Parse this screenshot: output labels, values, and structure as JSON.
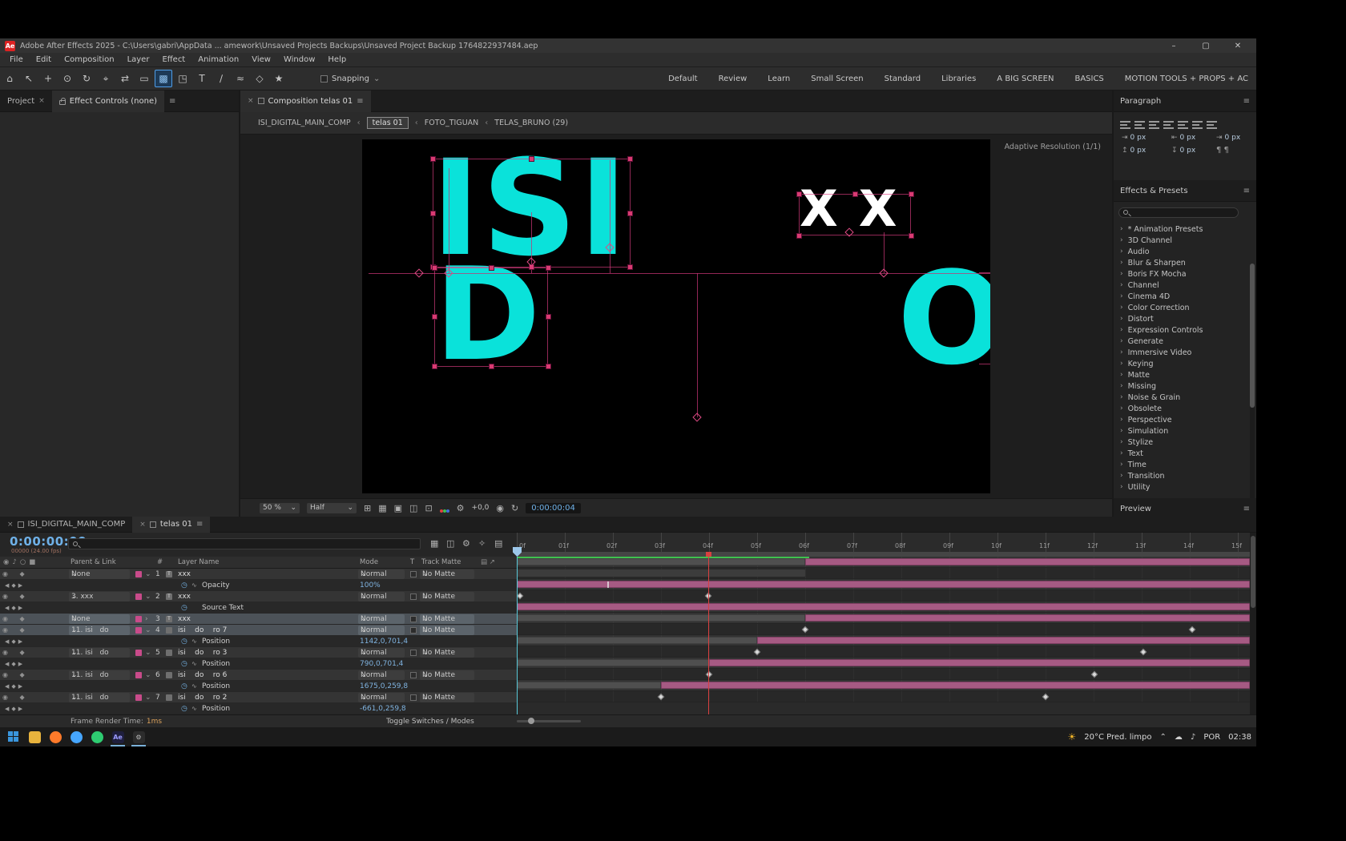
{
  "window": {
    "title": "Adobe After Effects 2025 - C:\\Users\\gabri\\AppData ... amework\\Unsaved Projects Backups\\Unsaved Project Backup 1764822937484.aep",
    "minimize": "–",
    "maximize": "▢",
    "close": "✕"
  },
  "menu": {
    "items": [
      "File",
      "Edit",
      "Composition",
      "Layer",
      "Effect",
      "Animation",
      "View",
      "Window",
      "Help"
    ]
  },
  "toolbar": {
    "snapping": "Snapping",
    "workspaces": [
      "Default",
      "Review",
      "Learn",
      "Small Screen",
      "Standard",
      "Libraries",
      "A BIG SCREEN",
      "BASICS",
      "MOTION TOOLS + PROPS + AC"
    ]
  },
  "panels": {
    "project_tab": "Project",
    "effect_controls_tab": "Effect Controls (none)"
  },
  "comp": {
    "tab": "Composition telas 01",
    "breadcrumbs": [
      "ISI_DIGITAL_MAIN_COMP",
      "telas 01",
      "FOTO_TIGUAN",
      "TELAS_BRUNO (29)"
    ],
    "adaptive_resolution": "Adaptive Resolution (1/1)",
    "canvas": {
      "word_top": "ISI",
      "letter_d": "D",
      "letter_o": "O",
      "xx": "XX"
    },
    "zoom": "50 %",
    "resolution": "Half",
    "exposure": "+0,0",
    "timecode": "0:00:00:04"
  },
  "paragraph": {
    "title": "Paragraph",
    "f1": "0 px",
    "f2": "0 px",
    "f3": "0 px",
    "f4": "0 px",
    "f5": "0 px"
  },
  "effects": {
    "title": "Effects & Presets",
    "items": [
      "* Animation Presets",
      "3D Channel",
      "Audio",
      "Blur & Sharpen",
      "Boris FX Mocha",
      "Channel",
      "Cinema 4D",
      "Color Correction",
      "Distort",
      "Expression Controls",
      "Generate",
      "Immersive Video",
      "Keying",
      "Matte",
      "Missing",
      "Noise & Grain",
      "Obsolete",
      "Perspective",
      "Simulation",
      "Stylize",
      "Text",
      "Time",
      "Transition",
      "Utility"
    ]
  },
  "preview": {
    "title": "Preview"
  },
  "timeline": {
    "tab1": "ISI_DIGITAL_MAIN_COMP",
    "tab2": "telas 01",
    "timecode": "0:00:00:00",
    "fps": "00000 (24.00 fps)",
    "h_parent": "Parent & Link",
    "h_name": "Layer Name",
    "h_mode": "Mode",
    "h_t": "T",
    "h_matte": "Track Matte",
    "ruler": [
      "0f",
      "01f",
      "02f",
      "03f",
      "04f",
      "05f",
      "06f",
      "07f",
      "08f",
      "09f",
      "10f",
      "11f",
      "12f",
      "13f",
      "14f",
      "15f"
    ],
    "rows": [
      {
        "type": "layer",
        "num": "1",
        "name": "xxx",
        "parent": "None",
        "mode": "Normal",
        "matte": "No Matte"
      },
      {
        "type": "prop",
        "name": "Opacity",
        "value": "100%"
      },
      {
        "type": "layer",
        "num": "2",
        "name": "xxx",
        "parent": "3. xxx",
        "mode": "Normal",
        "matte": "No Matte"
      },
      {
        "type": "prop",
        "name": "Source Text",
        "value": ""
      },
      {
        "type": "layer",
        "num": "3",
        "name": "xxx",
        "parent": "None",
        "mode": "Normal",
        "matte": "No Matte"
      },
      {
        "type": "layer",
        "num": "4",
        "name": "isi    do    ro 7",
        "parent": "11. isi   do",
        "mode": "Normal",
        "matte": "No Matte"
      },
      {
        "type": "prop",
        "name": "Position",
        "value": "1142,0,701,4"
      },
      {
        "type": "layer",
        "num": "5",
        "name": "isi    do    ro 3",
        "parent": "11. isi   do",
        "mode": "Normal",
        "matte": "No Matte"
      },
      {
        "type": "prop",
        "name": "Position",
        "value": "790,0,701,4"
      },
      {
        "type": "layer",
        "num": "6",
        "name": "isi    do    ro 6",
        "parent": "11. isi   do",
        "mode": "Normal",
        "matte": "No Matte"
      },
      {
        "type": "prop",
        "name": "Position",
        "value": "1675,0,259,8"
      },
      {
        "type": "layer",
        "num": "7",
        "name": "isi    do    ro 2",
        "parent": "11. isi   do",
        "mode": "Normal",
        "matte": "No Matte"
      },
      {
        "type": "prop",
        "name": "Position",
        "value": "-661,0,259,8"
      }
    ],
    "render_label": "Frame Render Time:",
    "render_value": "1ms",
    "toggle": "Toggle Switches / Modes"
  },
  "taskbar": {
    "weather": "20°C  Pred. limpo",
    "lang": "POR",
    "time": "02:38"
  }
}
